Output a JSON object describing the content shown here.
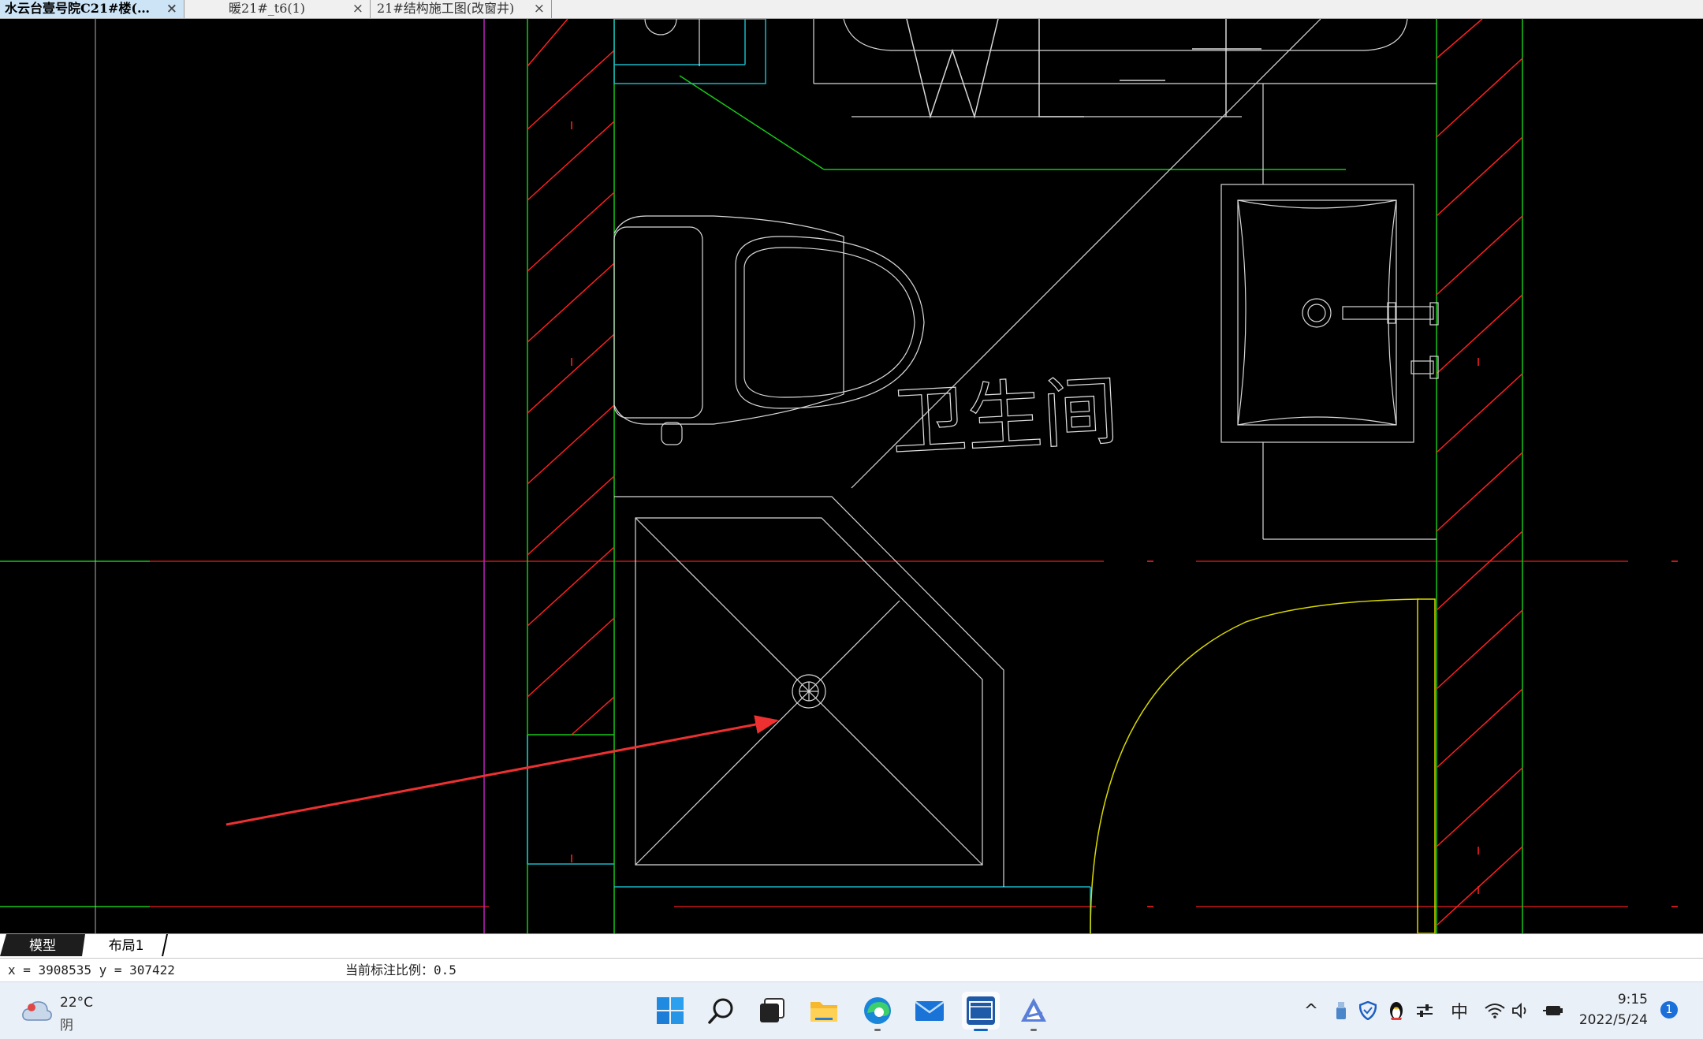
{
  "doc_tabs": [
    {
      "label": "水云台壹号院C21#楼(…",
      "active": true
    },
    {
      "label": "暖21#_t6(1)",
      "active": false
    },
    {
      "label": "21#结构施工图(改窗井)",
      "active": false
    }
  ],
  "tab_close_glyph": "×",
  "drawing": {
    "room_label": "卫生间",
    "line_colors": {
      "wall_hatch": "#ff2020",
      "axis": "#c81818",
      "wall": "#18c818",
      "window": "#18b8c8",
      "fixture": "#d8d8d8",
      "door_swing": "#d8d800",
      "magenta_line": "#c020c0",
      "pointer_arrow": "#ee3030"
    }
  },
  "layout_tabs": [
    {
      "label": "模型",
      "active": true
    },
    {
      "label": "布局1",
      "active": false
    }
  ],
  "status": {
    "coords": "x = 3908535 y = 307422",
    "scale": "当前标注比例：0.5"
  },
  "taskbar": {
    "weather": {
      "temp": "22°C",
      "desc": "阴",
      "icon": "cloudy-weather-icon"
    },
    "apps": [
      {
        "name": "windows-start-icon",
        "active": false,
        "running": false
      },
      {
        "name": "search-icon",
        "active": false,
        "running": false
      },
      {
        "name": "task-view-icon",
        "active": false,
        "running": false
      },
      {
        "name": "file-explorer-icon",
        "active": false,
        "running": false
      },
      {
        "name": "edge-browser-icon",
        "active": false,
        "running": true
      },
      {
        "name": "mail-icon",
        "active": false,
        "running": false
      },
      {
        "name": "cad-app-icon",
        "active": true,
        "running": true
      },
      {
        "name": "autocad-icon",
        "active": false,
        "running": true
      }
    ],
    "tray": {
      "chevron": "^",
      "ime": "中",
      "time": "9:15",
      "date": "2022/5/24",
      "notification_count": "1"
    }
  }
}
